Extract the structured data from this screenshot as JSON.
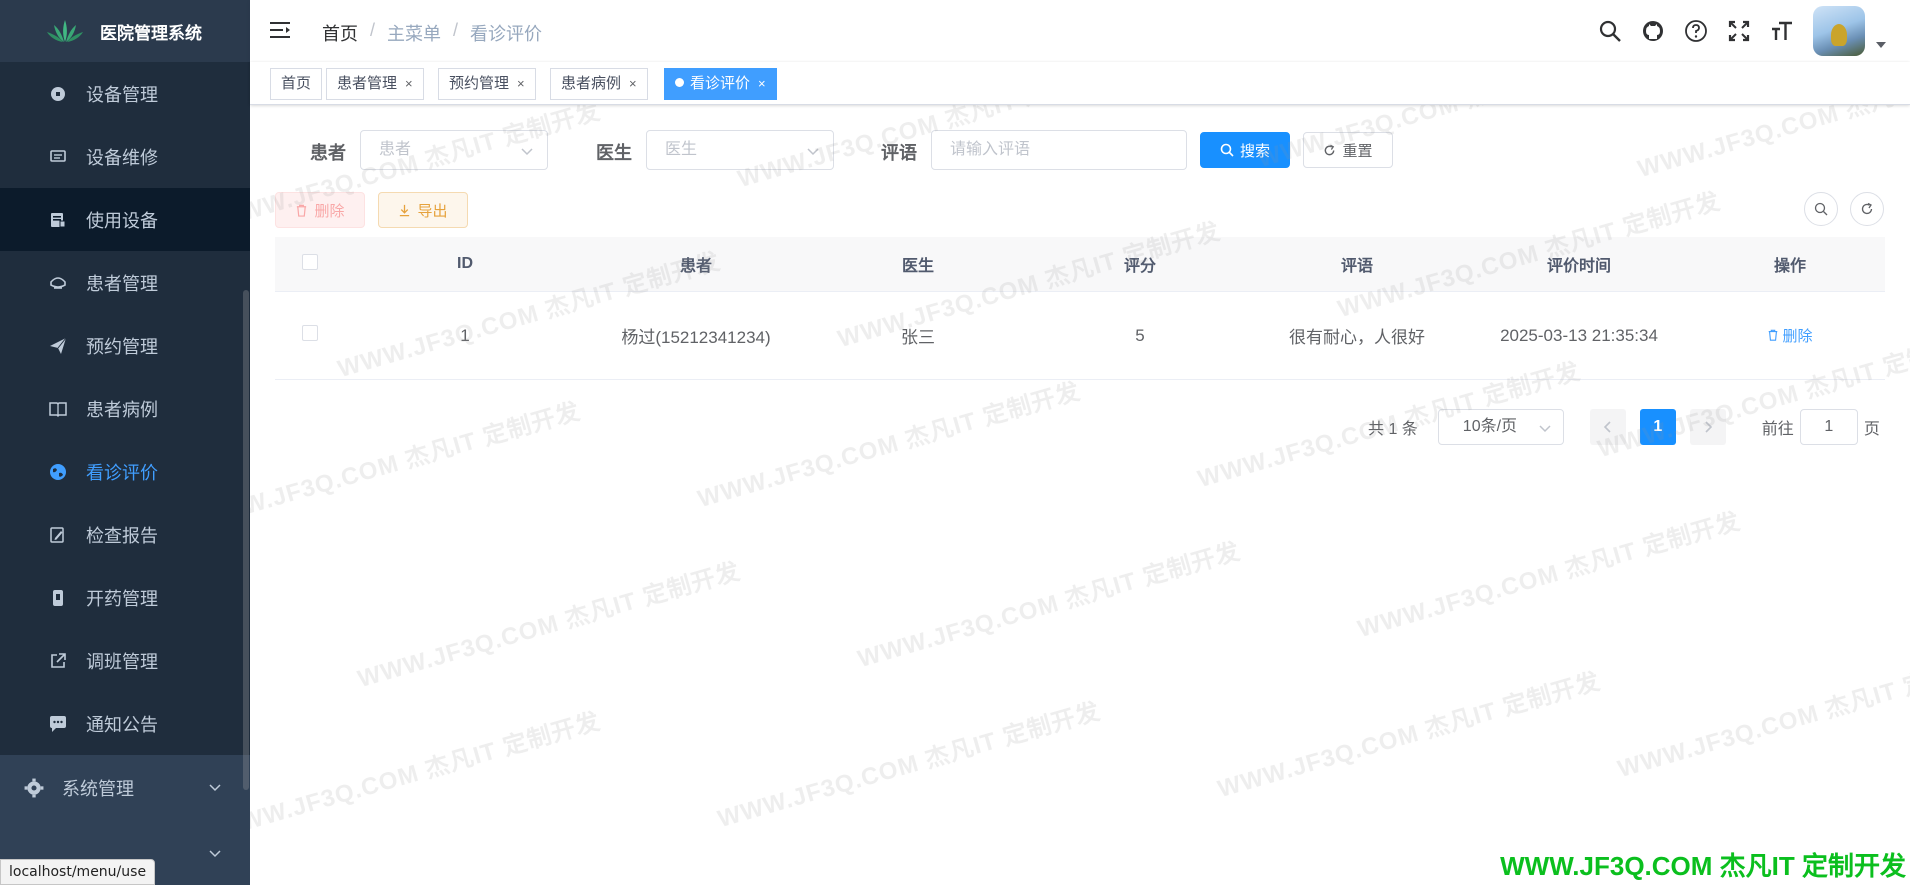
{
  "app": {
    "title": "医院管理系统"
  },
  "sidebar": {
    "items": [
      {
        "label": "设备管理",
        "icon": "component-icon"
      },
      {
        "label": "设备维修",
        "icon": "monitor-icon"
      },
      {
        "label": "使用设备",
        "icon": "clipboard-icon"
      },
      {
        "label": "患者管理",
        "icon": "user-mask-icon"
      },
      {
        "label": "预约管理",
        "icon": "paper-plane-icon"
      },
      {
        "label": "患者病例",
        "icon": "book-icon"
      },
      {
        "label": "看诊评价",
        "icon": "globe-icon"
      },
      {
        "label": "检查报告",
        "icon": "edit-doc-icon"
      },
      {
        "label": "开药管理",
        "icon": "pill-icon"
      },
      {
        "label": "调班管理",
        "icon": "external-link-icon"
      },
      {
        "label": "通知公告",
        "icon": "message-icon"
      }
    ],
    "system_menu": "系统管理",
    "status_url": "localhost/menu/use"
  },
  "navbar": {
    "breadcrumb": [
      "首页",
      "主菜单",
      "看诊评价"
    ],
    "breadcrumb_sep": "/"
  },
  "tags": {
    "home": "首页",
    "t1": "患者管理",
    "t2": "预约管理",
    "t3": "患者病例",
    "t4": "看诊评价",
    "close": "×"
  },
  "search": {
    "patient_label": "患者",
    "patient_placeholder": "患者",
    "doctor_label": "医生",
    "doctor_placeholder": "医生",
    "comment_label": "评语",
    "comment_placeholder": "请输入评语",
    "search_btn": "搜索",
    "reset_btn": "重置"
  },
  "toolbar": {
    "delete_btn": "删除",
    "export_btn": "导出"
  },
  "table": {
    "headers": [
      "ID",
      "患者",
      "医生",
      "评分",
      "评语",
      "评价时间",
      "操作"
    ],
    "rows": [
      {
        "id": "1",
        "patient": "杨过(15212341234)",
        "doctor": "张三",
        "score": "5",
        "comment": "很有耐心，人很好",
        "time": "2025-03-13 21:35:34",
        "action": "删除"
      }
    ]
  },
  "pagination": {
    "total": "共 1 条",
    "page_size": "10条/页",
    "current": "1",
    "goto_prefix": "前往",
    "goto_value": "1",
    "goto_suffix": "页"
  },
  "watermark": {
    "text": "WWW.JF3Q.COM 杰凡IT 定制开发",
    "color": "#0bbf1e"
  },
  "colors": {
    "sidebar_bg": "#304156",
    "primary": "#1890ff",
    "active_menu": "#409eff"
  }
}
